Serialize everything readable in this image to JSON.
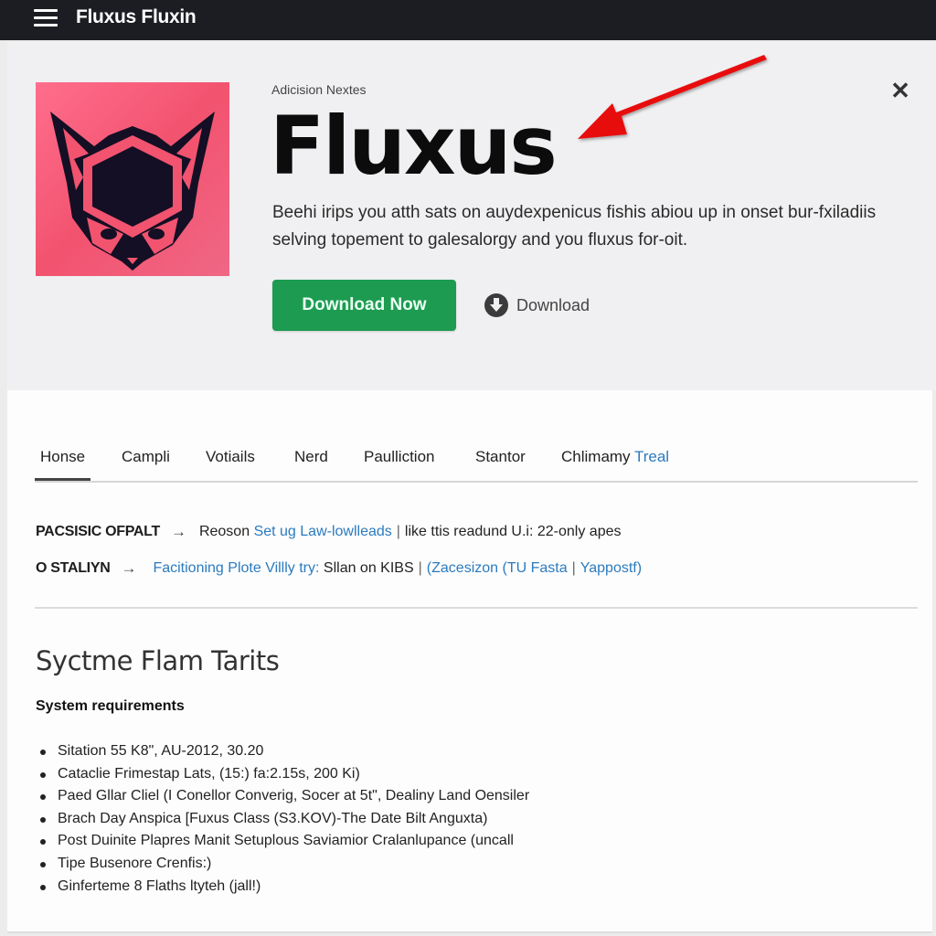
{
  "topbar": {
    "menu_icon": "hamburger-menu-icon",
    "title": "Fluxus Fluxin"
  },
  "hero": {
    "app_icon": "fox-mask-logo",
    "brand_colors": {
      "icon_bg": "#f2536f",
      "icon_fg": "#140f24"
    },
    "publisher": "Adicision Nextes",
    "title": "Fluxus",
    "description": "Beehi irips you atth sats on auydexpenicus fishis abiou up in onset bur-fxiladiis selving topement to galesalorgy and you fluxus for-oit.",
    "primary_button": "Download Now",
    "primary_color": "#1d9b51",
    "secondary_button": "Download",
    "secondary_icon": "download-circle-icon",
    "close_icon": "close-icon",
    "annotation": {
      "type": "red-arrow",
      "color": "#e8110f",
      "points_to": "product-title"
    }
  },
  "tabs": [
    {
      "label": "Honse",
      "active": true
    },
    {
      "label": "Campli"
    },
    {
      "label": "Votiails"
    },
    {
      "label": "Nerd"
    },
    {
      "label": "Paulliction"
    },
    {
      "label": "Stantor"
    },
    {
      "label": "Chlimamy",
      "accent": "Treal"
    }
  ],
  "info_rows": [
    {
      "label": "PACSISIC OFPALT",
      "prefix": "Reoson",
      "link": "Set ug Law-lowlleads",
      "separator": "|",
      "suffix": "like ttis readund U.i: 22-only apes"
    },
    {
      "label": "O STALIYN",
      "link": "Facitioning Plote Villly try:",
      "middle": "Sllan on KIBS",
      "separator": "|",
      "link2": "(Zacesizon (TU Fasta",
      "separator2": "|",
      "link3": "Yappostf)"
    }
  ],
  "section": {
    "title": "Syctme Flam Tarits",
    "subtitle": "System requirements",
    "requirements": [
      "Sitation 55 K8\", AU-2012, 30.20",
      "Cataclie Frimestap Lats, (15:) fa:2.15s, 200 Ki)",
      "Paed Gllar Cliel (I Conellor  Converig, Socer at 5t\", Dealiny Land Oensiler",
      "Brach Day Anspica [Fuxus Class (S3.KOV)-The Date Bilt Anguxta)",
      "Post Duinite Plapres  Manit Setuplous Saviamior Cralanlupance (uncall",
      "Tipe Busenore Crenfis:)",
      "Ginferteme 8 Flaths ltyteh (jall!)"
    ]
  }
}
